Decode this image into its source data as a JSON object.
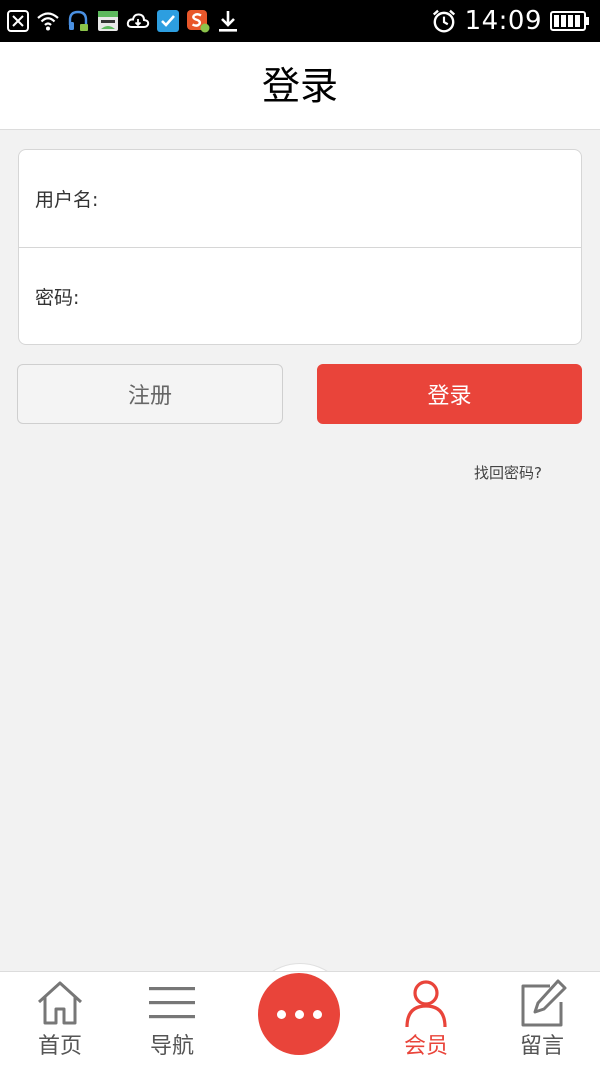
{
  "status_bar": {
    "time": "14:09",
    "left_icons": [
      "close-notification-icon",
      "wifi-icon",
      "headset-app-icon",
      "store-app-icon",
      "cloud-icon",
      "security-app-icon",
      "sogou-input-icon",
      "download-icon"
    ],
    "right_icons": [
      "alarm-clock-icon",
      "battery-icon"
    ]
  },
  "header": {
    "title": "登录"
  },
  "form": {
    "username": {
      "label": "用户名:",
      "value": "",
      "placeholder": ""
    },
    "password": {
      "label": "密码:",
      "value": "",
      "placeholder": ""
    }
  },
  "buttons": {
    "register": "注册",
    "login": "登录"
  },
  "forgot_password": "找回密码?",
  "bottom_nav": {
    "items": [
      {
        "label": "首页",
        "icon": "home-icon",
        "active": false
      },
      {
        "label": "导航",
        "icon": "menu-icon",
        "active": false
      },
      {
        "label": "会员",
        "icon": "user-icon",
        "active": true
      },
      {
        "label": "留言",
        "icon": "edit-icon",
        "active": false
      }
    ],
    "center_icon": "more-dots-icon"
  },
  "colors": {
    "accent": "#e9443a",
    "background": "#f2f2f2",
    "nav_icon": "#777777"
  }
}
